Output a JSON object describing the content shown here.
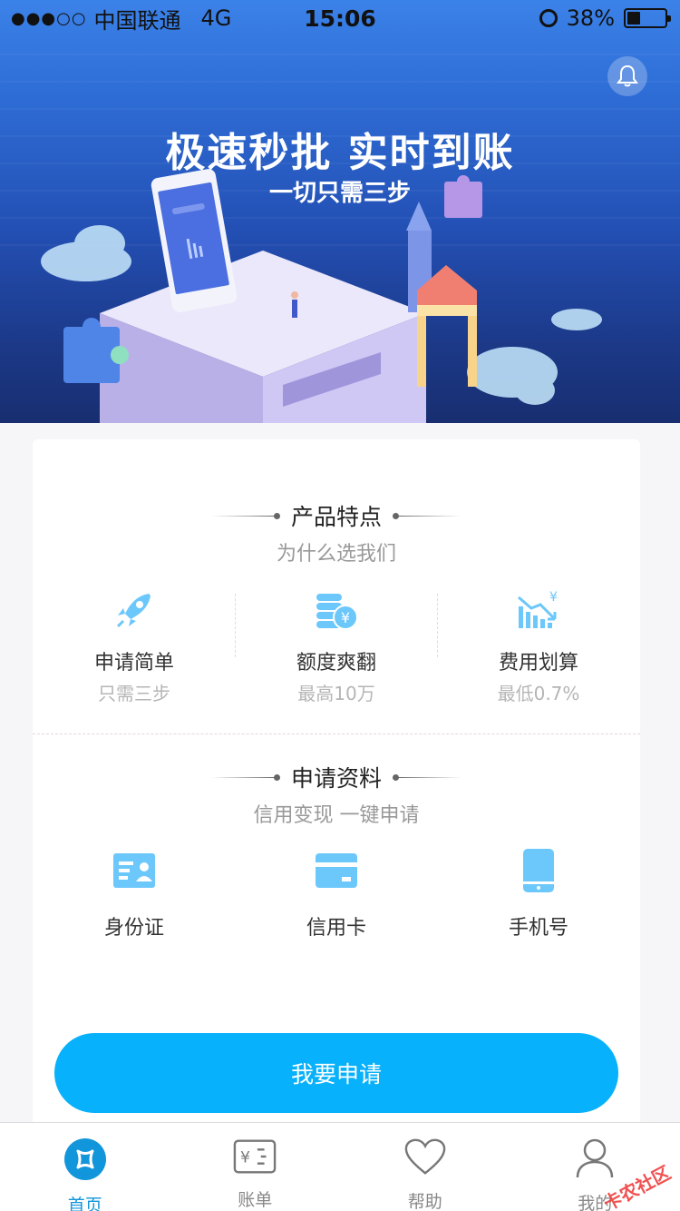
{
  "status_bar": {
    "signal": "●●●○○",
    "carrier": "中国联通",
    "network": "4G",
    "time": "15:06",
    "battery": "38%"
  },
  "hero": {
    "title": "极速秒批 实时到账",
    "subtitle": "一切只需三步"
  },
  "features_section": {
    "title": "产品特点",
    "subtitle": "为什么选我们",
    "items": [
      {
        "name": "申请简单",
        "desc": "只需三步",
        "icon": "rocket-icon"
      },
      {
        "name": "额度爽翻",
        "desc": "最高10万",
        "icon": "coins-icon"
      },
      {
        "name": "费用划算",
        "desc": "最低0.7%",
        "icon": "chart-down-icon"
      }
    ]
  },
  "materials_section": {
    "title": "申请资料",
    "subtitle": "信用变现 一键申请",
    "items": [
      {
        "name": "身份证",
        "icon": "id-card-icon"
      },
      {
        "name": "信用卡",
        "icon": "credit-card-icon"
      },
      {
        "name": "手机号",
        "icon": "phone-icon"
      }
    ]
  },
  "apply_button": "我要申请",
  "tabs": [
    {
      "label": "首页",
      "icon": "home-icon",
      "active": true
    },
    {
      "label": "账单",
      "icon": "bill-icon",
      "active": false
    },
    {
      "label": "帮助",
      "icon": "heart-icon",
      "active": false
    },
    {
      "label": "我的",
      "icon": "user-icon",
      "active": false
    }
  ],
  "watermark": "卡农社区",
  "colors": {
    "accent": "#07b1fb",
    "tab_active": "#1296db",
    "icon_light": "#6cc7fb"
  }
}
